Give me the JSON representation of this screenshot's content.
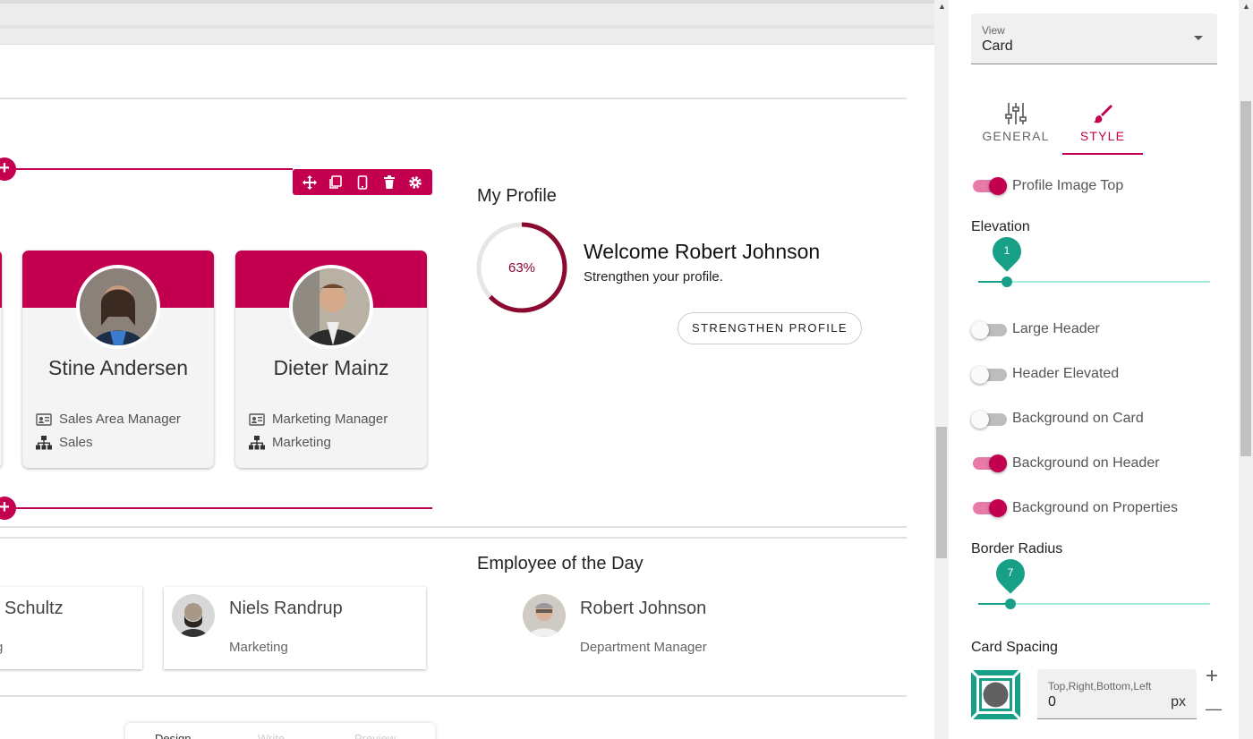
{
  "canvas": {
    "toolbar_icons": [
      "move-icon",
      "copy-icon",
      "mobile-icon",
      "delete-icon",
      "gear-icon"
    ],
    "cards": [
      {
        "name": "Stine Andersen",
        "title": "Sales Area Manager",
        "department": "Sales"
      },
      {
        "name": "Dieter Mainz",
        "title": "Marketing Manager",
        "department": "Marketing"
      }
    ],
    "my_profile": {
      "title": "My Profile",
      "percent_label": "63%",
      "percent": 63,
      "welcome": "Welcome Robert Johnson",
      "subtitle": "Strengthen your profile.",
      "button": "STRENGTHEN PROFILE"
    },
    "employees": [
      {
        "name": "Schultz",
        "department": "g"
      },
      {
        "name": "Niels Randrup",
        "department": "Marketing"
      }
    ],
    "employee_of_day": {
      "title": "Employee of the Day",
      "name": "Robert Johnson",
      "department": "Department Manager"
    },
    "bottom_tabs": [
      "Design",
      "Write",
      "Preview"
    ]
  },
  "panel": {
    "view": {
      "label": "View",
      "value": "Card"
    },
    "tabs": [
      {
        "label": "GENERAL"
      },
      {
        "label": "STYLE"
      }
    ],
    "active_tab": "STYLE",
    "toggles": [
      {
        "label": "Profile Image Top",
        "on": true
      },
      {
        "label": "Large Header",
        "on": false
      },
      {
        "label": "Header Elevated",
        "on": false
      },
      {
        "label": "Background on Card",
        "on": false
      },
      {
        "label": "Background on Header",
        "on": true
      },
      {
        "label": "Background on Properties",
        "on": true
      }
    ],
    "elevation": {
      "label": "Elevation",
      "value": "1"
    },
    "border_radius": {
      "label": "Border Radius",
      "value": "7"
    },
    "card_spacing": {
      "label": "Card Spacing",
      "field_label": "Top,Right,Bottom,Left",
      "value": "0",
      "unit": "px",
      "plus": "+",
      "minus": "—"
    }
  },
  "colors": {
    "accent": "#c2004f",
    "slider": "#17a087",
    "ring": "#8b0a2f"
  }
}
